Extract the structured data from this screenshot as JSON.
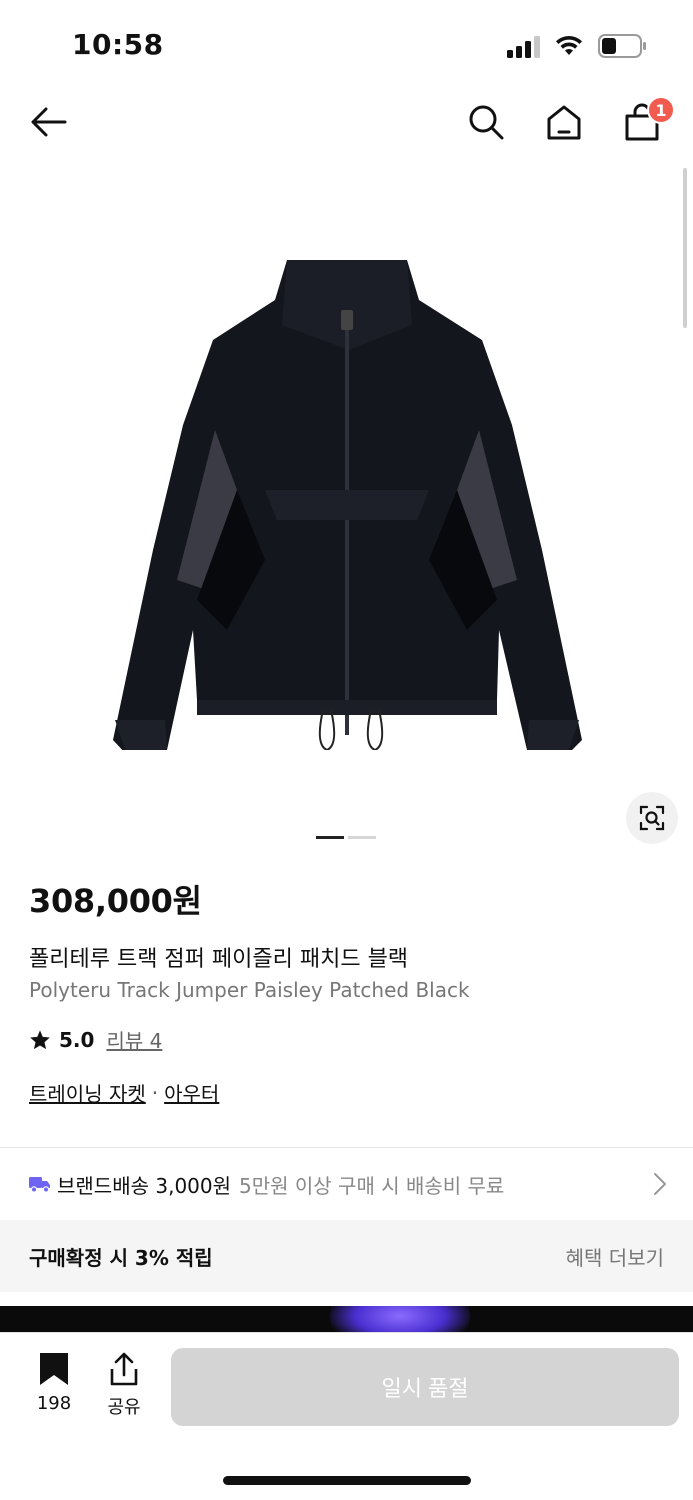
{
  "status_bar": {
    "time": "10:58",
    "icons": [
      "signal-icon",
      "wifi-icon",
      "battery-icon"
    ]
  },
  "nav": {
    "icons": [
      "back-arrow-icon",
      "search-icon",
      "home-icon",
      "shopping-bag-icon"
    ],
    "cart_badge": "1"
  },
  "gallery": {
    "image": "black track jumper with paisley side panels",
    "page_count": 2,
    "current_page": 1
  },
  "product": {
    "price": "308,000원",
    "name_ko": "폴리테루 트랙 점퍼 페이즐리 패치드 블랙",
    "name_en": "Polyteru Track Jumper Paisley Patched Black",
    "rating": "5.0",
    "review_link": "리뷰 4",
    "category_1": "트레이닝 자켓",
    "category_sep": "·",
    "category_2": "아우터"
  },
  "shipping": {
    "label": "브랜드배송 3,000원",
    "note": "5만원 이상 구매 시 배송비 무료"
  },
  "points": {
    "label": "구매확정 시 3% 적립",
    "link": "혜택 더보기"
  },
  "bottom_bar": {
    "bookmark_count": "198",
    "share_label": "공유",
    "soldout_label": "일시 품절"
  },
  "colors": {
    "badge": "#f25b4f",
    "truck": "#6f63f3",
    "soldout_button": "#d4d4d4"
  }
}
